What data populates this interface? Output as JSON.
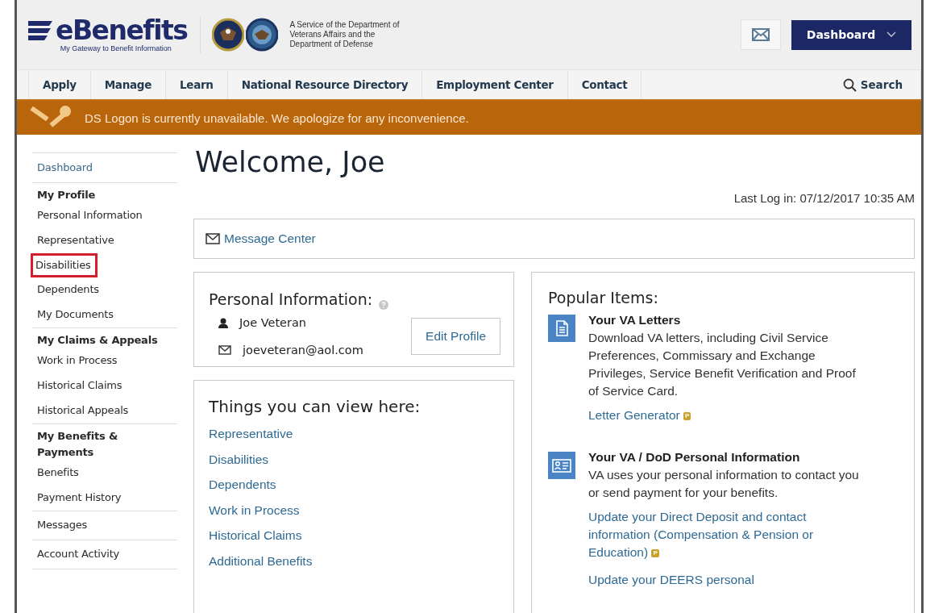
{
  "header": {
    "logo": "eBenefits",
    "tagline": "My Gateway to Benefit Information",
    "service_text": "A Service of the Department of Veterans Affairs and the Department of Defense",
    "dashboard_button": "Dashboard"
  },
  "nav": {
    "items": [
      {
        "label": "Apply"
      },
      {
        "label": "Manage"
      },
      {
        "label": "Learn"
      },
      {
        "label": "National Resource Directory"
      },
      {
        "label": "Employment Center"
      },
      {
        "label": "Contact"
      }
    ],
    "search": "Search"
  },
  "alert": {
    "message": "DS Logon is currently unavailable. We apologize for any inconvenience."
  },
  "sidebar": {
    "items": [
      {
        "kind": "link",
        "label": "Dashboard",
        "highlighted": false
      },
      {
        "kind": "heading",
        "label": "My Profile",
        "highlighted": false
      },
      {
        "kind": "item",
        "label": "Personal Information",
        "highlighted": false
      },
      {
        "kind": "item",
        "label": "Representative",
        "highlighted": false
      },
      {
        "kind": "item",
        "label": "Disabilities",
        "highlighted": true
      },
      {
        "kind": "item",
        "label": "Dependents",
        "highlighted": false
      },
      {
        "kind": "item",
        "label": "My Documents",
        "highlighted": false
      },
      {
        "kind": "heading",
        "label": "My Claims & Appeals",
        "highlighted": false
      },
      {
        "kind": "item",
        "label": "Work in Process",
        "highlighted": false
      },
      {
        "kind": "item",
        "label": "Historical Claims",
        "highlighted": false
      },
      {
        "kind": "item",
        "label": "Historical Appeals",
        "highlighted": false
      },
      {
        "kind": "heading",
        "label": "My Benefits & Payments",
        "highlighted": false
      },
      {
        "kind": "item",
        "label": "Benefits",
        "highlighted": false
      },
      {
        "kind": "item",
        "label": "Payment History",
        "highlighted": false
      },
      {
        "kind": "section",
        "label": "Messages",
        "highlighted": false
      },
      {
        "kind": "section",
        "label": "Account Activity",
        "highlighted": false
      }
    ]
  },
  "main": {
    "title": "Welcome, Joe",
    "last_login": "Last Log in: 07/12/2017 10:35 AM",
    "message_center": "Message Center",
    "personal_info": {
      "title": "Personal Information:",
      "name": "Joe Veteran",
      "email": "joeveteran@aol.com",
      "edit_button": "Edit Profile"
    },
    "things": {
      "title": "Things you can view here:",
      "links": [
        "Representative",
        "Disabilities",
        "Dependents",
        "Work in Process",
        "Historical Claims",
        "Additional Benefits"
      ]
    },
    "popular": {
      "title": "Popular Items:",
      "items": [
        {
          "kind": "letter",
          "title": "Your VA Letters",
          "description": "Download VA letters, including Civil Service Preferences, Commissary and Exchange Privileges, Service Benefit Verification and Proof of Service Card.",
          "links": [
            {
              "label": "Letter Generator",
              "badge": "P"
            }
          ]
        },
        {
          "kind": "id-card",
          "title": "Your VA / DoD Personal Information",
          "description": "VA uses your personal information to contact you or send payment for your benefits.",
          "links": [
            {
              "label": "Update your Direct Deposit and contact information (Compensation & Pension or Education)",
              "badge": "P"
            },
            {
              "label": "Update your DEERS personal"
            }
          ]
        }
      ]
    }
  }
}
